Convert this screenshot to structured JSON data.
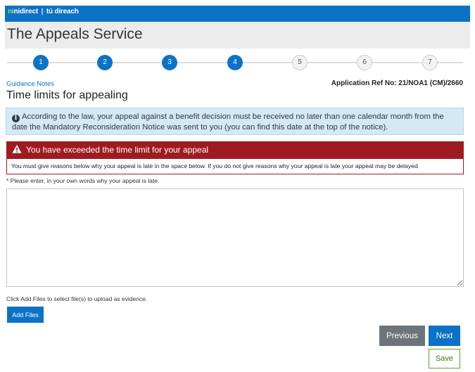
{
  "header": {
    "logo_primary": "nidirect",
    "logo_secondary": "tú direach",
    "service_title": "The Appeals Service",
    "brand_color": "#0b72c6"
  },
  "steps": {
    "items": [
      {
        "label": "1",
        "status": "complete"
      },
      {
        "label": "2",
        "status": "complete"
      },
      {
        "label": "3",
        "status": "complete"
      },
      {
        "label": "4",
        "status": "current"
      },
      {
        "label": "5",
        "status": "incomplete"
      },
      {
        "label": "6",
        "status": "incomplete"
      },
      {
        "label": "7",
        "status": "incomplete"
      }
    ]
  },
  "page": {
    "guidance_link": "Guidance Notes",
    "application_ref": "Application Ref No: 21/NOA1 (CM)/2660",
    "title": "Time limits for appealing"
  },
  "info_box": {
    "icon": "info-icon",
    "text": "According to the law, your appeal against a benefit decision must be received no later than one calendar month from the date the Mandatory Reconsideration Notice was sent to you (you can find this date at the top of the notice)."
  },
  "warning": {
    "icon": "warning-triangle-icon",
    "heading": "You have exceeded the time limit for your appeal",
    "body": "You must give reasons below why your appeal is late in the space below. If you do not give reasons why your appeal is late your appeal may be delayed",
    "color": "#9e1b21"
  },
  "reason_field": {
    "label": "* Please enter, in your own words why your appeal is late.",
    "value": ""
  },
  "evidence": {
    "instructions": "Click Add Files to select file(s) to upload as evidence.",
    "add_files_label": "Add Files"
  },
  "nav": {
    "previous_label": "Previous",
    "next_label": "Next",
    "save_label": "Save"
  }
}
